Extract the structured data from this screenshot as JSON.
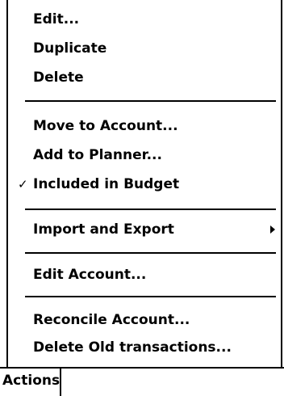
{
  "menu": {
    "items": [
      {
        "label": "Edit..."
      },
      {
        "label": "Duplicate"
      },
      {
        "label": "Delete"
      },
      {
        "label": "Move to Account..."
      },
      {
        "label": "Add to Planner..."
      },
      {
        "label": "Included in Budget",
        "checked": true,
        "check_glyph": "✓"
      },
      {
        "label": "Import and Export",
        "submenu_icon": "submenu-arrow-icon"
      },
      {
        "label": "Edit Account..."
      },
      {
        "label": "Reconcile Account..."
      },
      {
        "label": "Delete Old transactions..."
      }
    ]
  },
  "bottom_bar": {
    "tab_label": "Actions"
  }
}
